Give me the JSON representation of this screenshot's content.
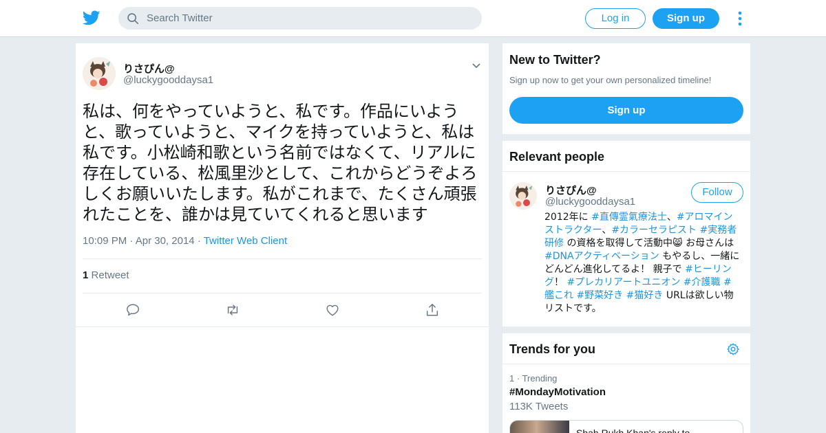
{
  "header": {
    "search_placeholder": "Search Twitter",
    "login_label": "Log in",
    "signup_label": "Sign up"
  },
  "tweet": {
    "author_name": "りさぴん@",
    "author_handle": "@luckygooddaysa1",
    "text": "私は、何をやっていようと、私です。作品にいようと、歌っていようと、マイクを持っていようと、私は私です。小松崎和歌という名前ではなくて、リアルに存在している、松風里沙として、これからどうぞよろしくお願いいたします。私がこれまで、たくさん頑張れたことを、誰かは見ていてくれると思います",
    "time": "10:09 PM",
    "date": "Apr 30, 2014",
    "client": "Twitter Web Client",
    "retweet_count": "1",
    "retweet_label": "Retweet"
  },
  "new_to_twitter": {
    "title": "New to Twitter?",
    "subtitle": "Sign up now to get your own personalized timeline!",
    "button": "Sign up"
  },
  "relevant_people": {
    "title": "Relevant people",
    "name": "りさぴん@",
    "handle": "@luckygooddaysa1",
    "follow_label": "Follow",
    "bio": {
      "p1": "2012年に ",
      "t1": "#直傳霊氣療法士",
      "p2": "、",
      "t2": "#アロマインストラクター",
      "p3": "、",
      "t3": "#カラーセラピスト",
      "p4": " ",
      "t4": "#実務者研修",
      "p5": " の資格を取得して活動中😸 お母さんは ",
      "t5": "#DNAアクティベーション",
      "p6": " もやるし、一緒にどんどん進化してるよ！ 親子で ",
      "t6": "#ヒーリング",
      "p7": "！ ",
      "t7": "#プレカリアートユニオン",
      "p8": " ",
      "t8": "#介護職",
      "p9": " ",
      "t9": "#艦これ",
      "p10": " ",
      "t10": "#野菜好き",
      "p11": " ",
      "t11": "#猫好き",
      "p12": " URLは欲しい物リストです。"
    }
  },
  "trends": {
    "title": "Trends for you",
    "items": [
      {
        "rank": "1",
        "context": "Trending",
        "name": "#MondayMotivation",
        "count": "113K Tweets",
        "card_text": "Shah Rukh Khan's reply to"
      }
    ]
  },
  "colors": {
    "accent": "#1da1f2",
    "link": "#1b95e0",
    "background": "#e6ecf0",
    "muted": "#657786"
  }
}
